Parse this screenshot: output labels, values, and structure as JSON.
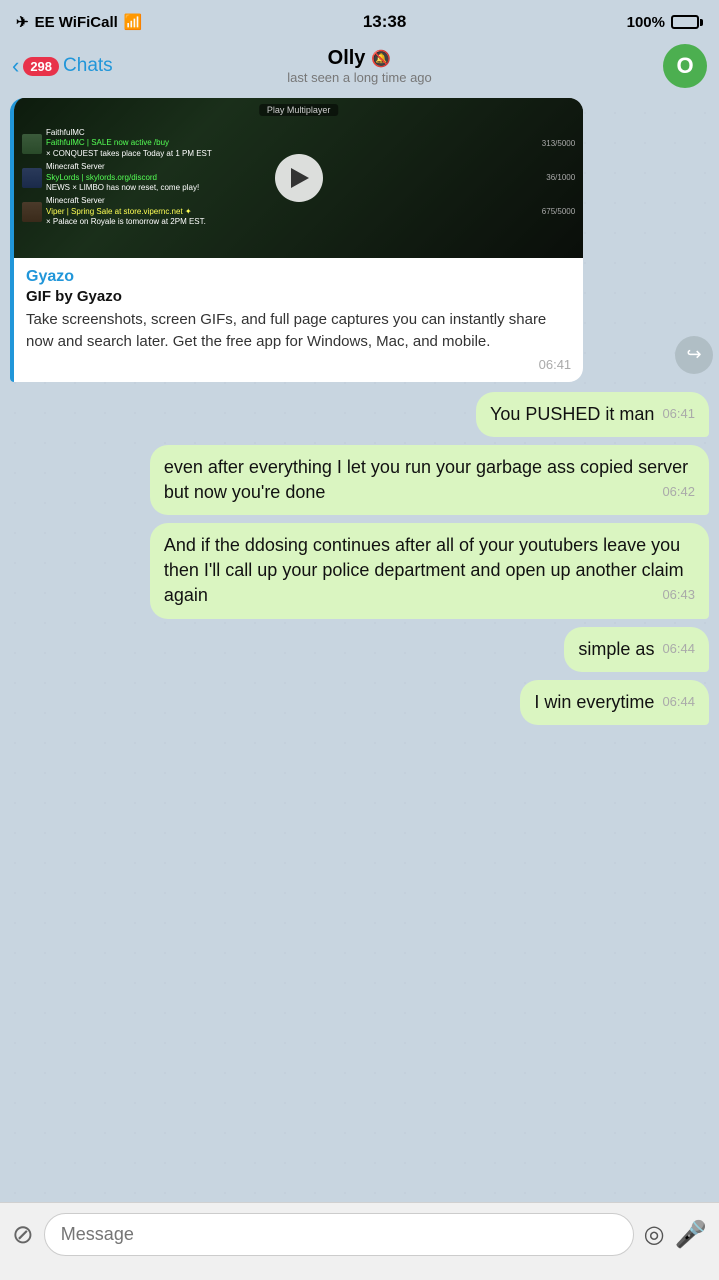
{
  "status_bar": {
    "carrier": "EE WiFiCall",
    "time": "13:38",
    "battery": "100%"
  },
  "header": {
    "back_label": "Chats",
    "badge_count": "298",
    "contact_name": "Olly",
    "mute_symbol": "🔇",
    "last_seen": "last seen a long time ago",
    "avatar_initial": "O"
  },
  "messages": [
    {
      "id": "media-msg",
      "type": "media",
      "direction": "incoming",
      "video_label": "Play Multiplayer",
      "link_brand": "Gyazo",
      "link_title": "GIF by Gyazo",
      "link_desc": "Take screenshots, screen GIFs, and full page captures you can instantly share now and search later. Get the free app for Windows, Mac, and mobile.",
      "time": "06:41"
    },
    {
      "id": "msg1",
      "type": "text",
      "direction": "outgoing",
      "text": "You PUSHED it man",
      "time": "06:41"
    },
    {
      "id": "msg2",
      "type": "text",
      "direction": "outgoing",
      "text": "even after everything I let you run your garbage ass copied server but now you're done",
      "time": "06:42"
    },
    {
      "id": "msg3",
      "type": "text",
      "direction": "outgoing",
      "text": "And if the ddosing continues after all of your youtubers leave you then I'll call up your police department and open up another claim again",
      "time": "06:43"
    },
    {
      "id": "msg4",
      "type": "text",
      "direction": "outgoing",
      "text": "simple as",
      "time": "06:44"
    },
    {
      "id": "msg5",
      "type": "text",
      "direction": "outgoing",
      "text": "I win everytime",
      "time": "06:44"
    }
  ],
  "input_bar": {
    "placeholder": "Message"
  },
  "icons": {
    "back_arrow": "‹",
    "mute": "🔇",
    "attach": "⊘",
    "emoji": "◎",
    "mic": "🎤",
    "forward": "↪"
  }
}
